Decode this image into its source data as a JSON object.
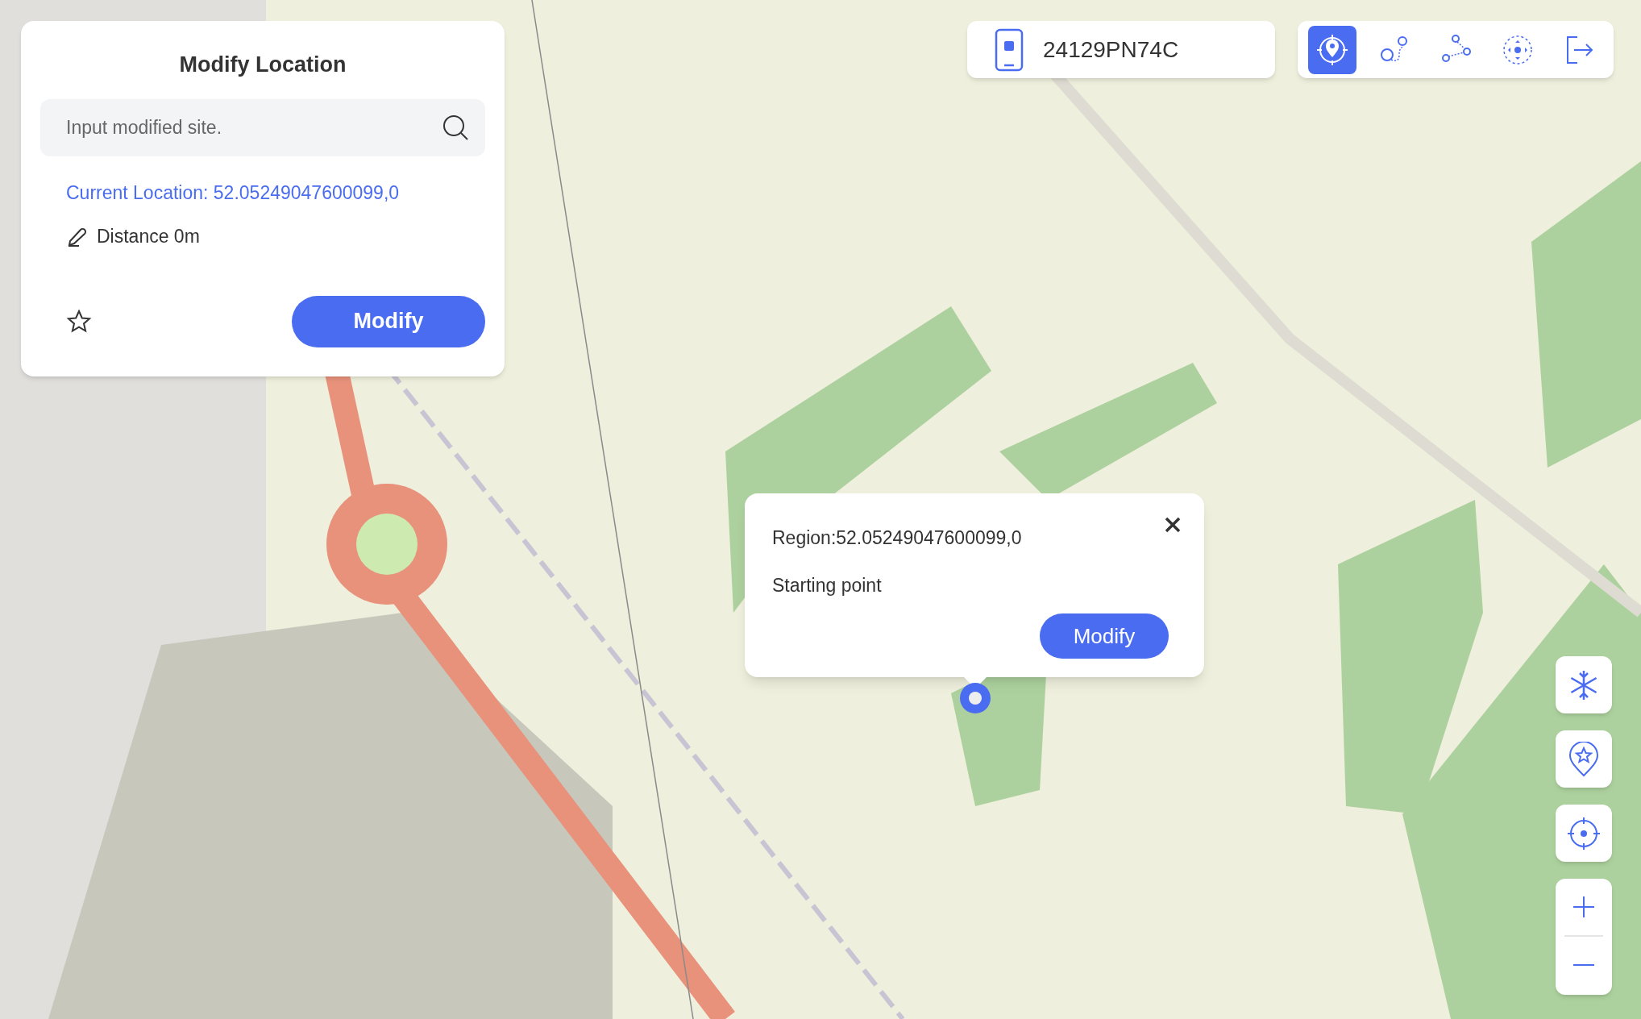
{
  "location_panel": {
    "title": "Modify Location",
    "search": {
      "placeholder": "Input modified site."
    },
    "current_location": "Current Location: 52.05249047600099,0",
    "distance": "Distance 0m",
    "favorite": false,
    "button": "Modify"
  },
  "device": {
    "name": "24129PN74C"
  },
  "toolbar": [
    {
      "kind": "teleport",
      "selected": true
    },
    {
      "kind": "two-spot",
      "selected": false
    },
    {
      "kind": "multi-spot",
      "selected": false
    },
    {
      "kind": "joystick",
      "selected": false
    },
    {
      "kind": "exit",
      "selected": false
    }
  ],
  "popup": {
    "region": "Region:52.05249047600099,0",
    "label": "Starting point",
    "button": "Modify"
  },
  "map_controls": [
    {
      "kind": "freeze"
    },
    {
      "kind": "favorites"
    },
    {
      "kind": "locate"
    },
    {
      "kind": "zoom"
    }
  ]
}
